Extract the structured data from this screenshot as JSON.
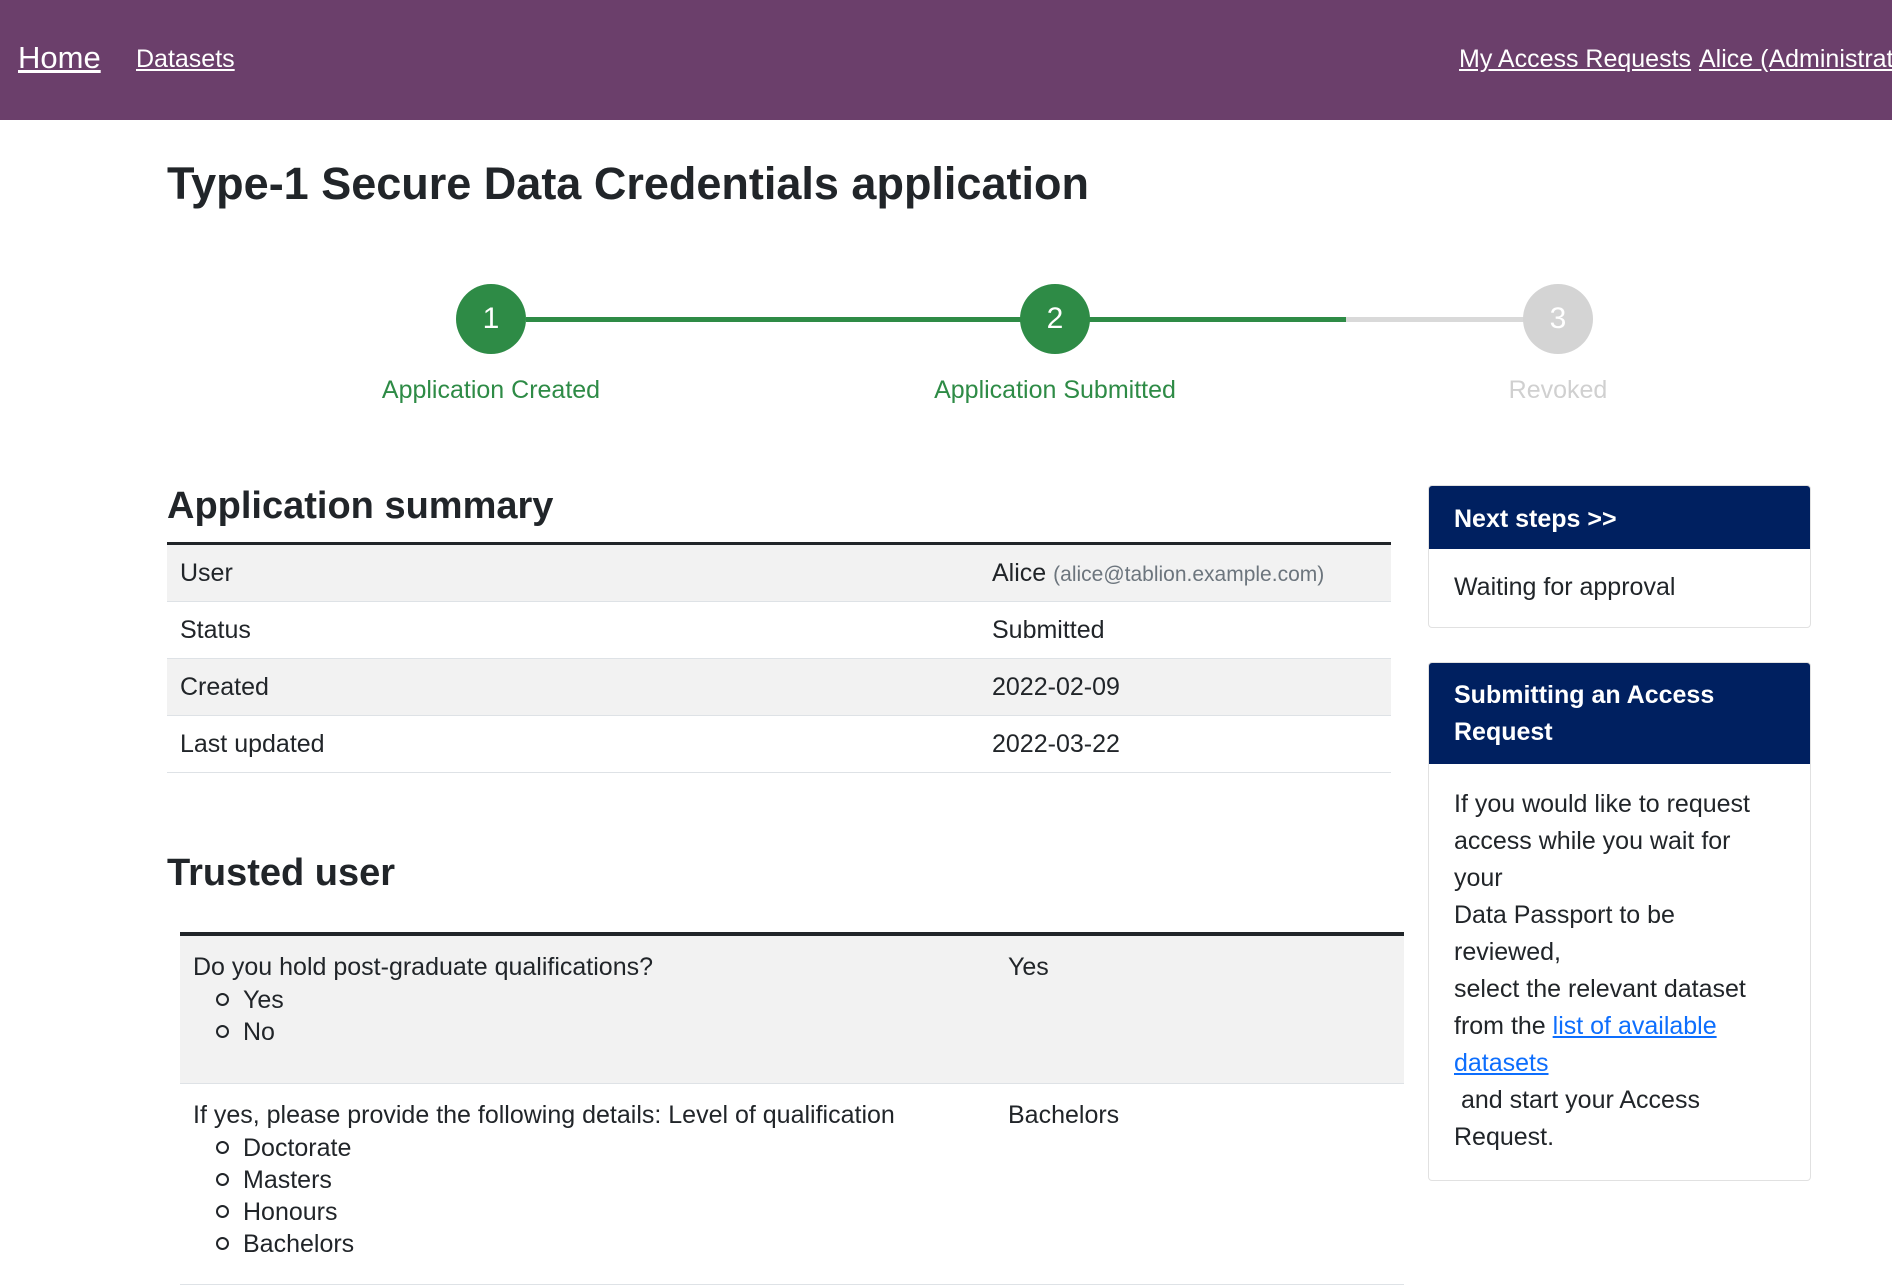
{
  "nav": {
    "home": "Home",
    "datasets": "Datasets",
    "my_access_requests": "My Access Requests",
    "user": "Alice (Administrat"
  },
  "page": {
    "title": "Type-1 Secure Data Credentials application"
  },
  "stepper": {
    "steps": [
      {
        "number": "1",
        "label": "Application Created",
        "state": "complete"
      },
      {
        "number": "2",
        "label": "Application Submitted",
        "state": "complete"
      },
      {
        "number": "3",
        "label": "Revoked",
        "state": "pending"
      }
    ],
    "colors": {
      "complete": "#2e8b46",
      "pending": "#d4d4d4"
    }
  },
  "summary": {
    "heading": "Application summary",
    "rows": [
      {
        "label": "User",
        "value": "Alice",
        "email": "(alice@tablion.example.com)"
      },
      {
        "label": "Status",
        "value": "Submitted"
      },
      {
        "label": "Created",
        "value": "2022-02-09"
      },
      {
        "label": "Last updated",
        "value": "2022-03-22"
      }
    ]
  },
  "trusted_user": {
    "heading": "Trusted user",
    "questions": [
      {
        "question": "Do you hold post-graduate qualifications?",
        "options": [
          "Yes",
          "No"
        ],
        "answer": "Yes"
      },
      {
        "question": "If yes, please provide the following details: Level of qualification",
        "options": [
          "Doctorate",
          "Masters",
          "Honours",
          "Bachelors"
        ],
        "answer": "Bachelors"
      }
    ]
  },
  "cards": {
    "next_steps": {
      "title": "Next steps >>",
      "body": "Waiting for approval"
    },
    "access_request": {
      "title_line1": "Submitting an Access",
      "title_line2": "Request",
      "body_line1": "If you would like to request",
      "body_line2": "access while you wait for your",
      "body_line3": "Data Passport to be reviewed,",
      "body_line4": "select the relevant dataset",
      "body_line5_prefix": "from the ",
      "link_part1": "list of available",
      "link_part2": "datasets",
      "body_line6_suffix": " and start your Access",
      "body_line7": "Request."
    }
  },
  "colors": {
    "header_bg": "#6b3f6b",
    "card_header_bg": "#002060",
    "link": "#0d6efd"
  }
}
